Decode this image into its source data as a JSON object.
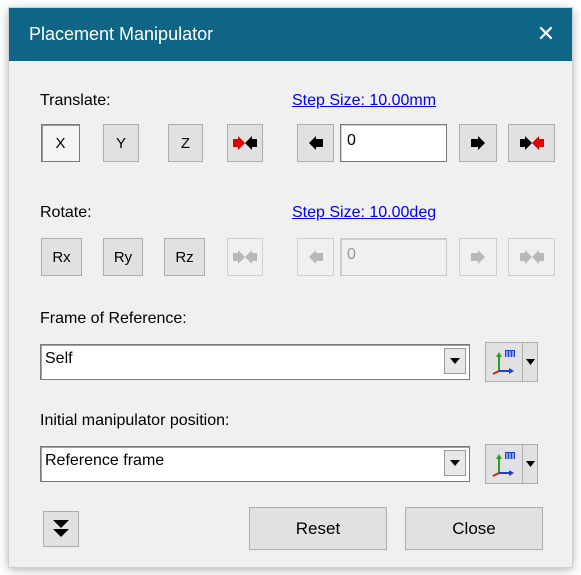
{
  "window": {
    "title": "Placement Manipulator",
    "close_glyph": "✕"
  },
  "translate": {
    "label": "Translate:",
    "step_size": "Step Size: 10.00mm",
    "axes": [
      "X",
      "Y",
      "Z"
    ],
    "value": "0",
    "active_axis": "X",
    "arrow_color": "#e00000"
  },
  "rotate": {
    "label": "Rotate:",
    "step_size": "Step Size: 10.00deg",
    "axes": [
      "Rx",
      "Ry",
      "Rz"
    ],
    "value": "0",
    "disabled": true
  },
  "frame_of_reference": {
    "label": "Frame of Reference:",
    "selected": "Self",
    "icon": "frame-axes-icon"
  },
  "initial_position": {
    "label": "Initial manipulator position:",
    "selected": "Reference frame",
    "icon": "frame-axes-icon"
  },
  "footer": {
    "expand_icon": "double-chevron-down-icon",
    "reset_label": "Reset",
    "close_label": "Close"
  }
}
